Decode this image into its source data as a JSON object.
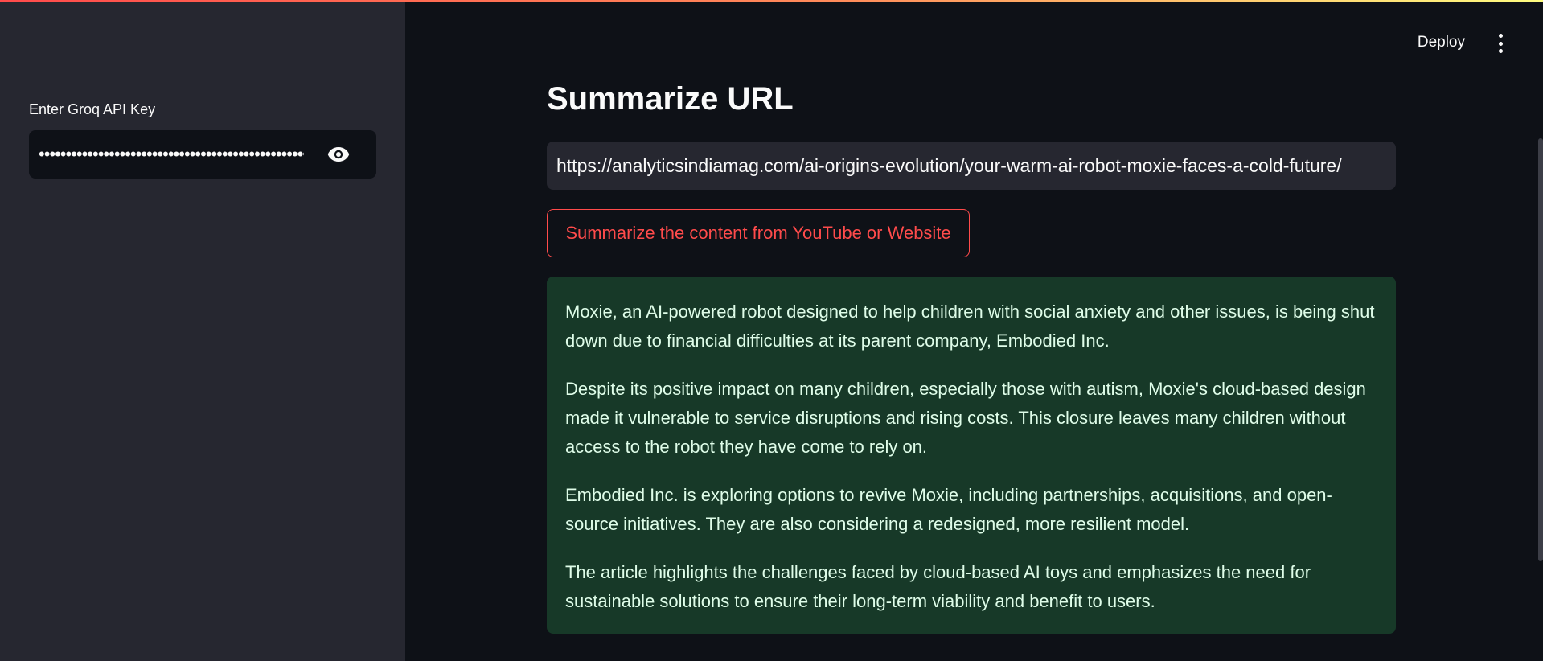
{
  "sidebar": {
    "api_label": "Enter Groq API Key",
    "api_value": "••••••••••••••••••••••••••••••••••••••••••••••••••••",
    "reveal_icon": "eye-icon"
  },
  "header": {
    "deploy_label": "Deploy",
    "menu_icon": "vertical-ellipsis-icon"
  },
  "main": {
    "title": "Summarize URL",
    "url_value": "https://analyticsindiamag.com/ai-origins-evolution/your-warm-ai-robot-moxie-faces-a-cold-future/",
    "button_label": "Summarize the content from YouTube or Website",
    "summary": [
      "Moxie, an AI-powered robot designed to help children with social anxiety and other issues, is being shut down due to financial difficulties at its parent company, Embodied Inc.",
      "Despite its positive impact on many children, especially those with autism, Moxie's cloud-based design made it vulnerable to service disruptions and rising costs. This closure leaves many children without access to the robot they have come to rely on.",
      "Embodied Inc. is exploring options to revive Moxie, including partnerships, acquisitions, and open-source initiatives. They are also considering a redesigned, more resilient model.",
      "The article highlights the challenges faced by cloud-based AI toys and emphasizes the need for sustainable solutions to ensure their long-term viability and benefit to users."
    ]
  },
  "colors": {
    "primary": "#ff4b4b",
    "sidebar_bg": "#262730",
    "main_bg": "#0e1117",
    "success_bg": "#173928",
    "success_text": "#dffde9"
  }
}
